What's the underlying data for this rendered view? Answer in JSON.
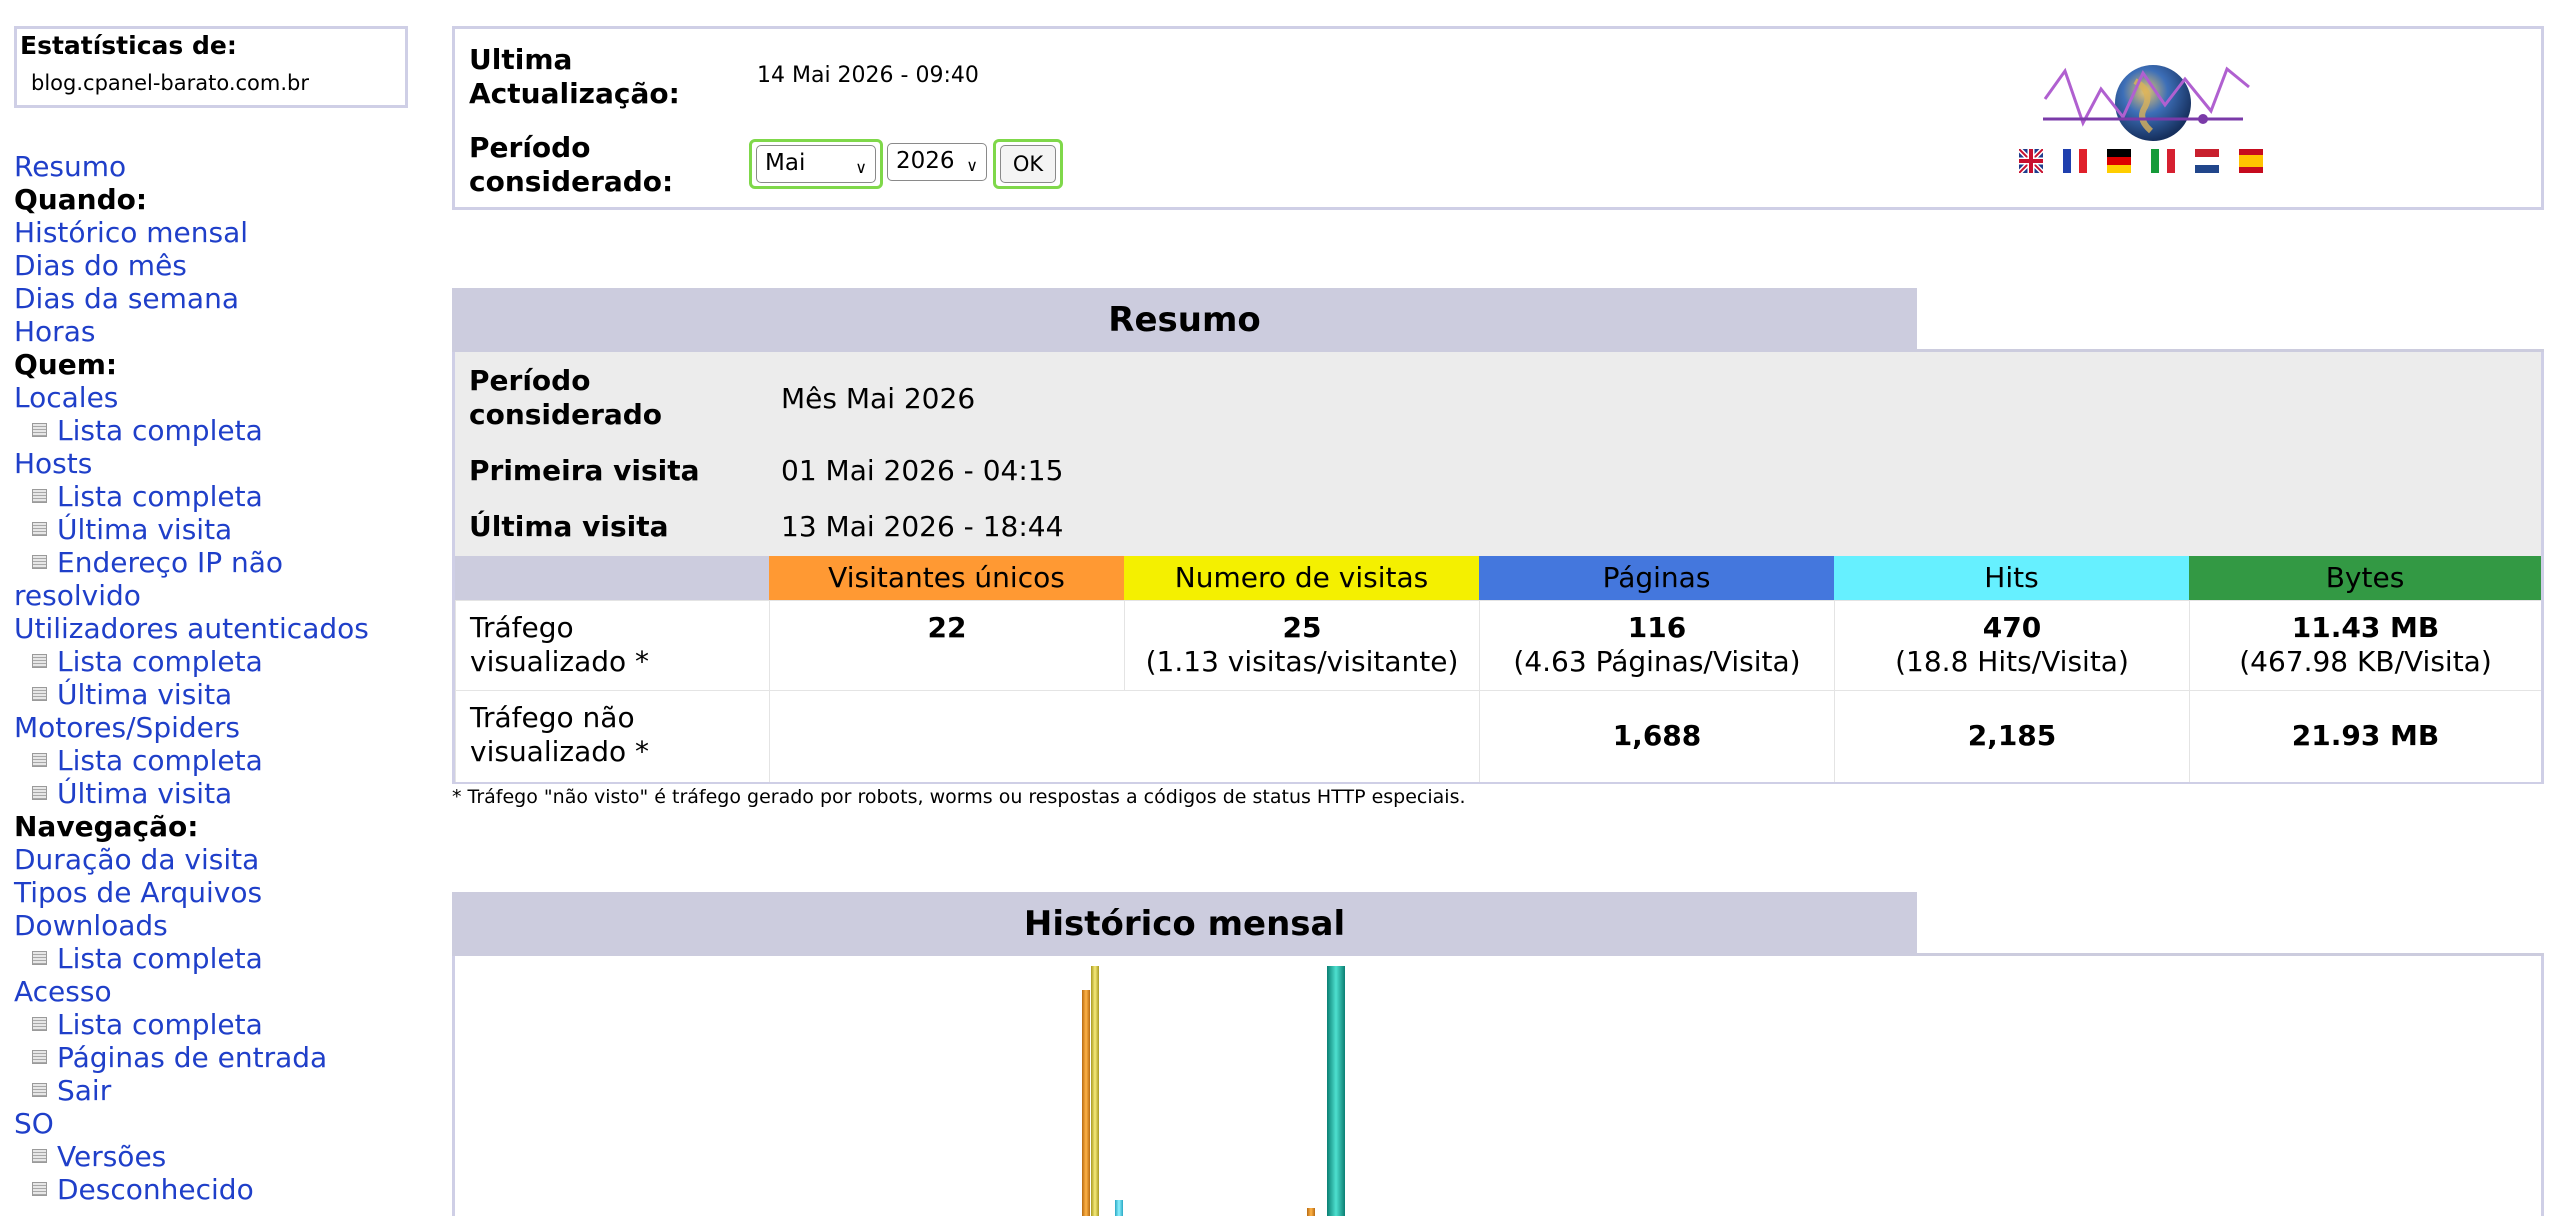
{
  "sidebar": {
    "stats_title": "Estatísticas de:",
    "domain": "blog.cpanel-barato.com.br",
    "menu": [
      {
        "type": "link",
        "label": "Resumo"
      },
      {
        "type": "head",
        "label": "Quando:"
      },
      {
        "type": "link",
        "label": "Histórico mensal"
      },
      {
        "type": "link",
        "label": "Dias do mês"
      },
      {
        "type": "link",
        "label": "Dias da semana"
      },
      {
        "type": "link",
        "label": "Horas"
      },
      {
        "type": "head",
        "label": "Quem:"
      },
      {
        "type": "link",
        "label": "Locales"
      },
      {
        "type": "sub",
        "label": "Lista completa"
      },
      {
        "type": "link",
        "label": "Hosts"
      },
      {
        "type": "sub",
        "label": "Lista completa"
      },
      {
        "type": "sub",
        "label": "Última visita"
      },
      {
        "type": "sub",
        "label": "Endereço IP não"
      },
      {
        "type": "link",
        "label": "resolvido"
      },
      {
        "type": "link",
        "label": "Utilizadores autenticados"
      },
      {
        "type": "sub",
        "label": "Lista completa"
      },
      {
        "type": "sub",
        "label": "Última visita"
      },
      {
        "type": "link",
        "label": "Motores/Spiders"
      },
      {
        "type": "sub",
        "label": "Lista completa"
      },
      {
        "type": "sub",
        "label": "Última visita"
      },
      {
        "type": "head",
        "label": "Navegação:"
      },
      {
        "type": "link",
        "label": "Duração da visita"
      },
      {
        "type": "link",
        "label": "Tipos de Arquivos"
      },
      {
        "type": "link",
        "label": "Downloads"
      },
      {
        "type": "sub",
        "label": "Lista completa"
      },
      {
        "type": "link",
        "label": "Acesso"
      },
      {
        "type": "sub",
        "label": "Lista completa"
      },
      {
        "type": "sub",
        "label": "Páginas de entrada"
      },
      {
        "type": "sub",
        "label": "Sair"
      },
      {
        "type": "link",
        "label": "SO"
      },
      {
        "type": "sub",
        "label": "Versões"
      },
      {
        "type": "sub",
        "label": "Desconhecido"
      }
    ]
  },
  "top": {
    "update_label": "Ultima\nActualização:",
    "update_value": "14 Mai 2026 - 09:40",
    "period_label": "Período\nconsiderado:",
    "month_value": "Mai",
    "year_value": "2026",
    "ok_label": "OK",
    "flags": [
      "uk-flag",
      "fr-flag",
      "de-flag",
      "it-flag",
      "nl-flag",
      "es-flag"
    ]
  },
  "resumo": {
    "title": "Resumo",
    "period_label": "Período\nconsiderado",
    "period_value": "Mês Mai 2026",
    "first_visit_label": "Primeira visita",
    "first_visit_value": "01 Mai 2026 - 04:15",
    "last_visit_label": "Última visita",
    "last_visit_value": "13 Mai 2026 - 18:44",
    "columns": [
      {
        "label": "Visitantes únicos",
        "color": "#ff9933"
      },
      {
        "label": "Numero de visitas",
        "color": "#f4f000"
      },
      {
        "label": "Páginas",
        "color": "#4477dd"
      },
      {
        "label": "Hits",
        "color": "#66f0ff"
      },
      {
        "label": "Bytes",
        "color": "#339944"
      }
    ],
    "header_blank_color": "#ccccde",
    "row_viewed": {
      "label": "Tráfego\nvisualizado *",
      "unique": "22",
      "visits": "25",
      "visits_sub": "(1.13 visitas/visitante)",
      "pages": "116",
      "pages_sub": "(4.63 Páginas/Visita)",
      "hits": "470",
      "hits_sub": "(18.8 Hits/Visita)",
      "bytes": "11.43 MB",
      "bytes_sub": "(467.98 KB/Visita)"
    },
    "row_not_viewed": {
      "label": "Tráfego não\nvisualizado *",
      "pages": "1,688",
      "hits": "2,185",
      "bytes": "21.93 MB"
    },
    "footnote": "* Tráfego \"não visto\" é tráfego gerado por robots, worms ou respostas a códigos de status HTTP especiais."
  },
  "historico": {
    "title": "Histórico mensal"
  },
  "colors": {
    "section_header": "#ccccde",
    "panel_border": "#cfcfe6",
    "link": "#1f3fc9",
    "focus_ring": "#7fd84a"
  }
}
